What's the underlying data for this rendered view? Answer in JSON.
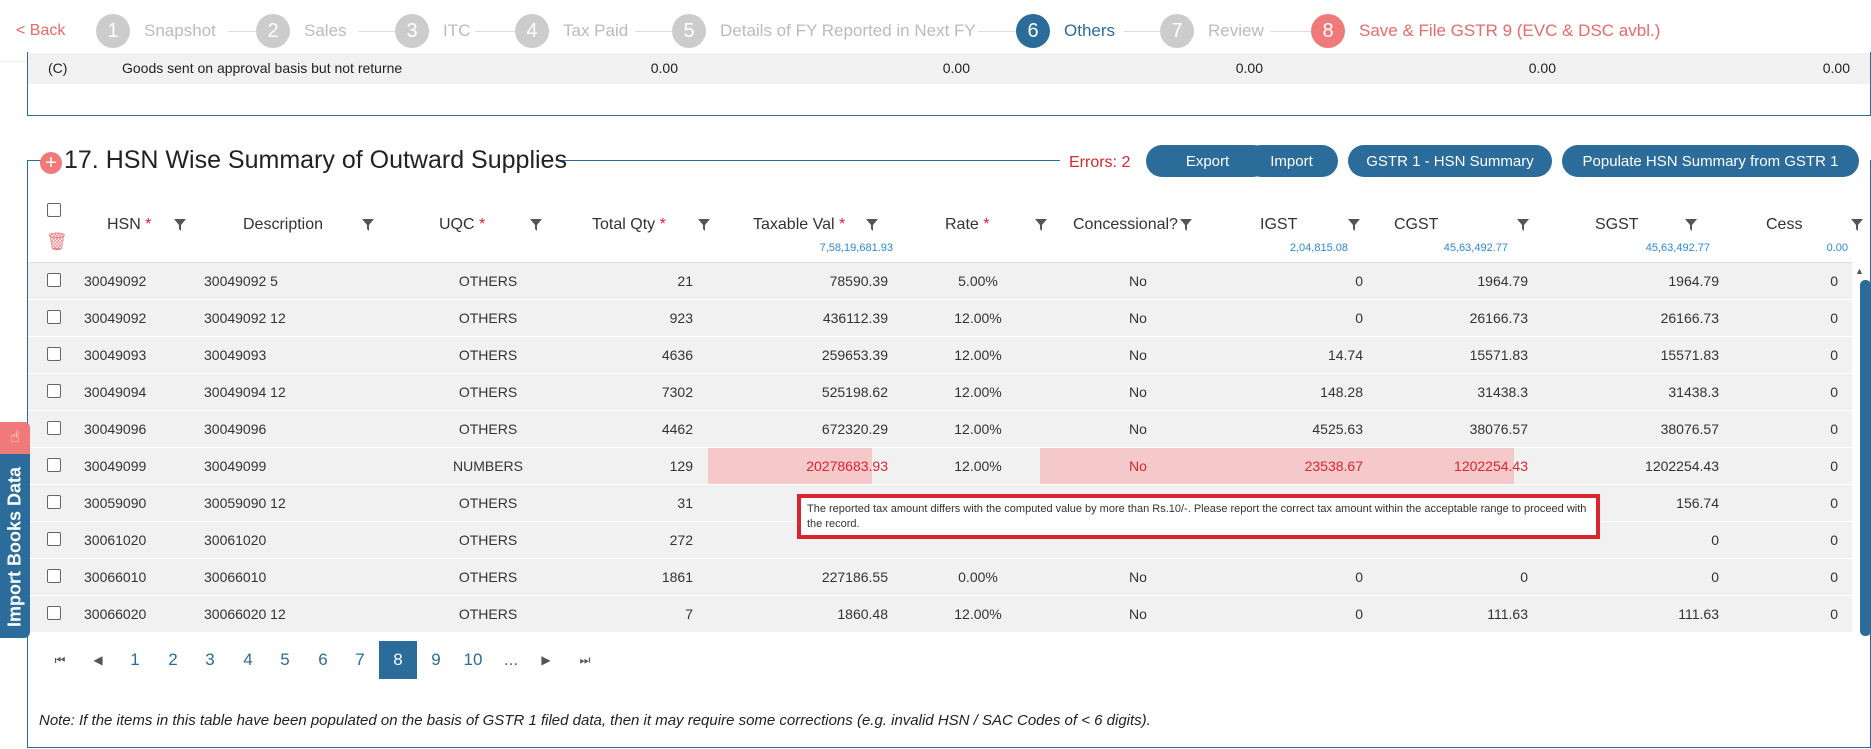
{
  "nav": {
    "back_label": "< Back",
    "steps": [
      {
        "num": "1",
        "label": "Snapshot"
      },
      {
        "num": "2",
        "label": "Sales"
      },
      {
        "num": "3",
        "label": "ITC"
      },
      {
        "num": "4",
        "label": "Tax Paid"
      },
      {
        "num": "5",
        "label": "Details of FY Reported in Next FY"
      },
      {
        "num": "6",
        "label": "Others"
      },
      {
        "num": "7",
        "label": "Review"
      },
      {
        "num": "8",
        "label": "Save & File GSTR 9 (EVC & DSC avbl.)"
      }
    ],
    "active_step": "6"
  },
  "upper_row": {
    "code": "(C)",
    "label": "Goods sent on approval basis but not returne",
    "values": [
      "0.00",
      "0.00",
      "0.00",
      "0.00",
      "0.00"
    ]
  },
  "section": {
    "title": "17. HSN Wise Summary of Outward Supplies",
    "errors": "Errors: 2",
    "buttons": {
      "export": "Export",
      "import": "Import",
      "hsn_summary": "GSTR 1 - HSN Summary",
      "populate": "Populate HSN Summary from GSTR 1"
    }
  },
  "table": {
    "headers": {
      "hsn": "HSN",
      "description": "Description",
      "uqc": "UQC",
      "total_qty": "Total Qty",
      "taxable_val": "Taxable Val",
      "rate": "Rate",
      "concessional": "Concessional?",
      "igst": "IGST",
      "cgst": "CGST",
      "sgst": "SGST",
      "cess": "Cess",
      "required_mark": "*"
    },
    "totals": {
      "taxable_val": "7,58,19,681.93",
      "igst": "2,04,815.08",
      "cgst": "45,63,492.77",
      "sgst": "45,63,492.77",
      "cess": "0.00"
    },
    "rows": [
      {
        "hsn": "30049092",
        "desc": "30049092 5",
        "uqc": "OTHERS",
        "qty": "21",
        "taxable": "78590.39",
        "rate": "5.00%",
        "conc": "No",
        "igst": "0",
        "cgst": "1964.79",
        "sgst": "1964.79",
        "cess": "0"
      },
      {
        "hsn": "30049092",
        "desc": "30049092 12",
        "uqc": "OTHERS",
        "qty": "923",
        "taxable": "436112.39",
        "rate": "12.00%",
        "conc": "No",
        "igst": "0",
        "cgst": "26166.73",
        "sgst": "26166.73",
        "cess": "0"
      },
      {
        "hsn": "30049093",
        "desc": "30049093",
        "uqc": "OTHERS",
        "qty": "4636",
        "taxable": "259653.39",
        "rate": "12.00%",
        "conc": "No",
        "igst": "14.74",
        "cgst": "15571.83",
        "sgst": "15571.83",
        "cess": "0"
      },
      {
        "hsn": "30049094",
        "desc": "30049094 12",
        "uqc": "OTHERS",
        "qty": "7302",
        "taxable": "525198.62",
        "rate": "12.00%",
        "conc": "No",
        "igst": "148.28",
        "cgst": "31438.3",
        "sgst": "31438.3",
        "cess": "0"
      },
      {
        "hsn": "30049096",
        "desc": "30049096",
        "uqc": "OTHERS",
        "qty": "4462",
        "taxable": "672320.29",
        "rate": "12.00%",
        "conc": "No",
        "igst": "4525.63",
        "cgst": "38076.57",
        "sgst": "38076.57",
        "cess": "0"
      },
      {
        "hsn": "30049099",
        "desc": "30049099",
        "uqc": "NUMBERS",
        "qty": "129",
        "taxable": "20278683.93",
        "rate": "12.00%",
        "conc": "No",
        "igst": "23538.67",
        "cgst": "1202254.43",
        "sgst": "1202254.43",
        "cess": "0"
      },
      {
        "hsn": "30059090",
        "desc": "30059090 12",
        "uqc": "OTHERS",
        "qty": "31",
        "taxable": "",
        "rate": "",
        "conc": "",
        "igst": "",
        "cgst": "",
        "sgst": "156.74",
        "cess": "0"
      },
      {
        "hsn": "30061020",
        "desc": "30061020",
        "uqc": "OTHERS",
        "qty": "272",
        "taxable": "",
        "rate": "",
        "conc": "",
        "igst": "",
        "cgst": "",
        "sgst": "0",
        "cess": "0"
      },
      {
        "hsn": "30066010",
        "desc": "30066010",
        "uqc": "OTHERS",
        "qty": "1861",
        "taxable": "227186.55",
        "rate": "0.00%",
        "conc": "No",
        "igst": "0",
        "cgst": "0",
        "sgst": "0",
        "cess": "0"
      },
      {
        "hsn": "30066020",
        "desc": "30066020 12",
        "uqc": "OTHERS",
        "qty": "7",
        "taxable": "1860.48",
        "rate": "12.00%",
        "conc": "No",
        "igst": "0",
        "cgst": "111.63",
        "sgst": "111.63",
        "cess": "0"
      }
    ],
    "tooltip": "The reported tax amount differs with the computed value by more than Rs.10/-. Please report the correct tax amount within the acceptable range to proceed with the record."
  },
  "pagination": {
    "first": "⏮",
    "prev": "◀",
    "next": "▶",
    "last": "⏭",
    "pages": [
      "1",
      "2",
      "3",
      "4",
      "5",
      "6",
      "7",
      "8",
      "9",
      "10",
      "..."
    ],
    "current": "8"
  },
  "note": "Note: If the items in this table have been populated on the basis of GSTR 1 filed data, then it may require some corrections (e.g. invalid HSN / SAC Codes of < 6 digits).",
  "side_tab": {
    "label": "Import Books Data"
  },
  "colors": {
    "accent": "#2b6c9a",
    "error": "#d9252f",
    "error_bg": "#f5c9c9",
    "final_step": "#f07a7a"
  }
}
